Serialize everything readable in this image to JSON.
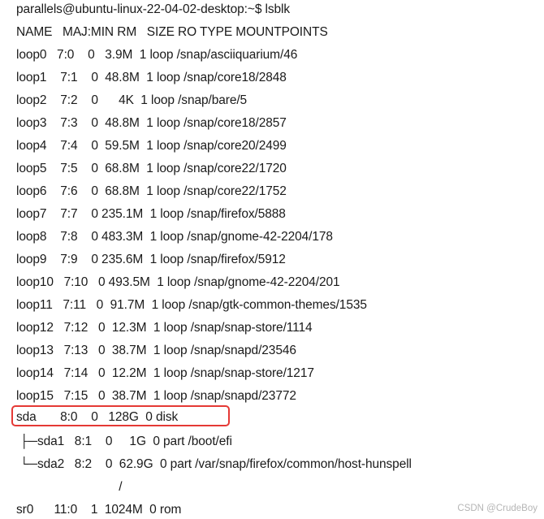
{
  "terminal": {
    "lines": [
      "parallels@ubuntu-linux-22-04-02-desktop:~$ lsblk",
      "NAME   MAJ:MIN RM   SIZE RO TYPE MOUNTPOINTS",
      "loop0   7:0    0   3.9M  1 loop /snap/asciiquarium/46",
      "loop1    7:1    0  48.8M  1 loop /snap/core18/2848",
      "loop2    7:2    0      4K  1 loop /snap/bare/5",
      "loop3    7:3    0  48.8M  1 loop /snap/core18/2857",
      "loop4    7:4    0  59.5M  1 loop /snap/core20/2499",
      "loop5    7:5    0  68.8M  1 loop /snap/core22/1720",
      "loop6    7:6    0  68.8M  1 loop /snap/core22/1752",
      "loop7    7:7    0 235.1M  1 loop /snap/firefox/5888",
      "loop8    7:8    0 483.3M  1 loop /snap/gnome-42-2204/178",
      "loop9    7:9    0 235.6M  1 loop /snap/firefox/5912",
      "loop10   7:10   0 493.5M  1 loop /snap/gnome-42-2204/201",
      "loop11   7:11   0  91.7M  1 loop /snap/gtk-common-themes/1535",
      "loop12   7:12   0  12.3M  1 loop /snap/snap-store/1114",
      "loop13   7:13   0  38.7M  1 loop /snap/snapd/23546",
      "loop14   7:14   0  12.2M  1 loop /snap/snap-store/1217",
      "loop15   7:15   0  38.7M  1 loop /snap/snapd/23772",
      "sda       8:0    0   128G  0 disk",
      " ├─sda1   8:1    0     1G  0 part /boot/efi",
      " └─sda2   8:2    0  62.9G  0 part /var/snap/firefox/common/host-hunspell",
      "                              /",
      "sr0      11:0    1  1024M  0 rom"
    ]
  },
  "watermark": "CSDN @CrudeBoy"
}
